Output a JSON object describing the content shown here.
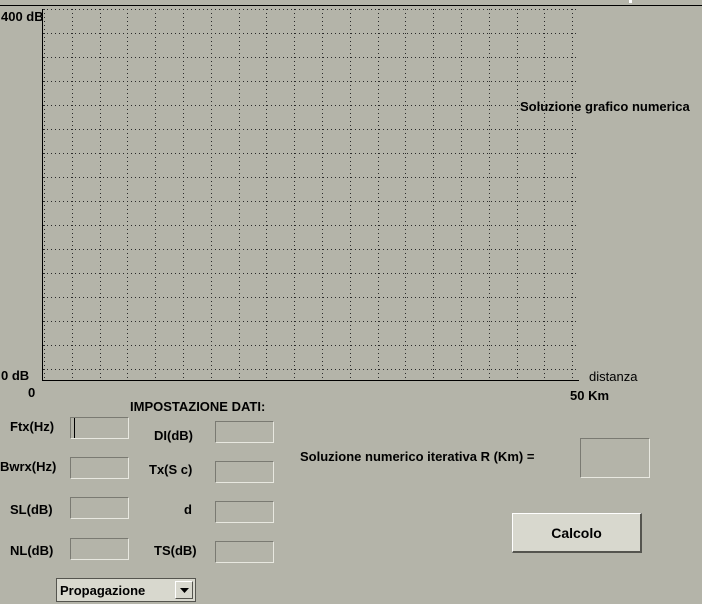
{
  "chart": {
    "y_max_label": "400 dB",
    "y_min_label": "0 dB",
    "x_origin_label": "0",
    "x_max_label": "50 Km",
    "x_axis_label": "distanza",
    "graph_title": "Soluzione grafico numerica",
    "grid": true
  },
  "chart_data": {
    "type": "line",
    "title": "Soluzione grafico numerica",
    "xlabel": "distanza",
    "ylabel": "",
    "xlim": [
      0,
      50
    ],
    "ylim": [
      0,
      400
    ],
    "x_ticks": [
      "0",
      "50 Km"
    ],
    "y_ticks": [
      "0 dB",
      "400 dB"
    ],
    "grid": true,
    "series": []
  },
  "form": {
    "section_title": "IMPOSTAZIONE DATI:",
    "fields": {
      "ftx": {
        "label": "Ftx(Hz)",
        "value": ""
      },
      "bwrx": {
        "label": "Bwrx(Hz)",
        "value": ""
      },
      "sl": {
        "label": "SL(dB)",
        "value": ""
      },
      "nl": {
        "label": "NL(dB)",
        "value": ""
      },
      "di": {
        "label": "DI(dB)",
        "value": ""
      },
      "tx": {
        "label": "Tx(S  c)",
        "value": ""
      },
      "d": {
        "label": "d",
        "value": ""
      },
      "ts": {
        "label": "TS(dB)",
        "value": ""
      }
    },
    "propagation": {
      "selected": "Propagazione"
    }
  },
  "result": {
    "label": "Soluzione numerico iterativa  R (Km) =",
    "value": ""
  },
  "buttons": {
    "calcolo": "Calcolo"
  }
}
